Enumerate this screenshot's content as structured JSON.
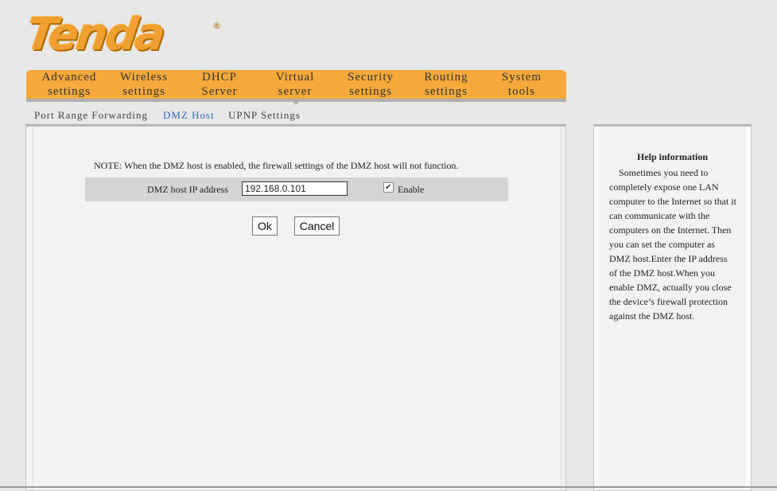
{
  "brand": {
    "logo_text": "Tenda",
    "registered_mark": "®"
  },
  "nav": {
    "items": [
      {
        "line1": "Advanced",
        "line2": "settings"
      },
      {
        "line1": "Wireless",
        "line2": "settings"
      },
      {
        "line1": "DHCP",
        "line2": "Server"
      },
      {
        "line1": "Virtual",
        "line2": "server"
      },
      {
        "line1": "Security",
        "line2": "settings"
      },
      {
        "line1": "Routing",
        "line2": "settings"
      },
      {
        "line1": "System",
        "line2": "tools"
      }
    ],
    "active": "Virtual server"
  },
  "subnav": {
    "items": [
      "Port Range Forwarding",
      "DMZ Host",
      "UPNP Settings"
    ],
    "active": "DMZ Host"
  },
  "dmz": {
    "note": "NOTE: When the DMZ host is enabled, the firewall settings of the DMZ host will not function.",
    "ip_label": "DMZ host IP address",
    "ip_value": "192.168.0.101",
    "enable_label": "Enable",
    "enable_checked": true,
    "ok_label": "Ok",
    "cancel_label": "Cancel"
  },
  "help": {
    "title": "Help information",
    "text": "Sometimes you need to completely expose one LAN computer to the Internet so that it can communicate with the computers on the Internet. Then you can set the computer as DMZ host.Enter the IP address of the DMZ host.When you enable DMZ, actually you close the device’s firewall protection against the DMZ host."
  },
  "colors": {
    "accent": "#f5a93a",
    "active_link": "#3566c6",
    "logo": "#f0a030"
  }
}
